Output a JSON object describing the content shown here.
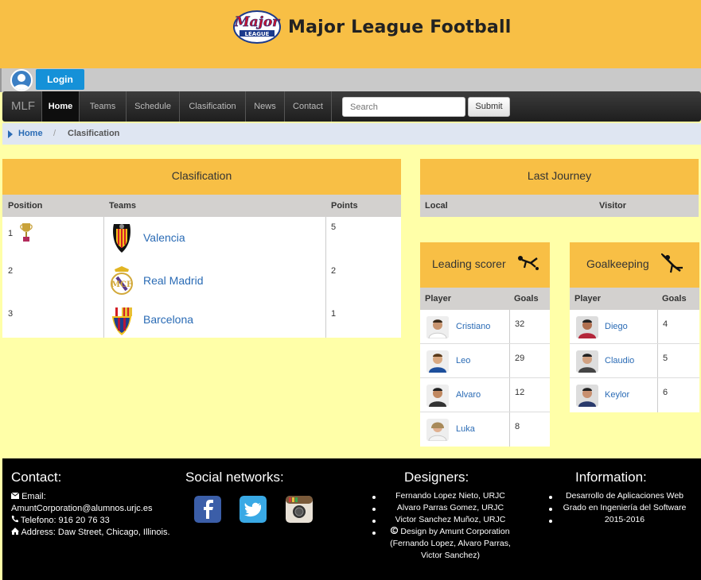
{
  "header": {
    "title": "Major League Football",
    "logo_text": "Major League"
  },
  "login": {
    "label": "Login"
  },
  "nav": {
    "brand": "MLF",
    "items": [
      "Home",
      "Teams",
      "Schedule",
      "Clasification",
      "News",
      "Contact"
    ],
    "active": "Home",
    "search_placeholder": "Search",
    "submit_label": "Submit"
  },
  "breadcrumb": {
    "home": "Home",
    "separator": "/",
    "current": "Clasification"
  },
  "clasification": {
    "title": "Clasification",
    "columns": [
      "Position",
      "Teams",
      "Points"
    ],
    "rows": [
      {
        "position": "1",
        "team": "Valencia",
        "points": "5",
        "trophy": true
      },
      {
        "position": "2",
        "team": "Real Madrid",
        "points": "2"
      },
      {
        "position": "3",
        "team": "Barcelona",
        "points": "1"
      }
    ]
  },
  "last_journey": {
    "title": "Last Journey",
    "columns": [
      "Local",
      "Visitor"
    ]
  },
  "leading_scorer": {
    "title": "Leading scorer",
    "columns": [
      "Player",
      "Goals"
    ],
    "rows": [
      {
        "player": "Cristiano",
        "goals": "32"
      },
      {
        "player": "Leo",
        "goals": "29"
      },
      {
        "player": "Alvaro",
        "goals": "12"
      },
      {
        "player": "Luka",
        "goals": "8"
      }
    ]
  },
  "goalkeeping": {
    "title": "Goalkeeping",
    "columns": [
      "Player",
      "Goals"
    ],
    "rows": [
      {
        "player": "Diego",
        "goals": "4"
      },
      {
        "player": "Claudio",
        "goals": "5"
      },
      {
        "player": "Keylor",
        "goals": "6"
      }
    ]
  },
  "footer": {
    "contact": {
      "title": "Contact:",
      "email_label": "Email:",
      "email": "AmuntCorporation@alumnos.urjc.es",
      "phone": "Telefono: 916 20 76 33",
      "address": "Address: Daw Street, Chicago, Illinois."
    },
    "social": {
      "title": "Social networks:"
    },
    "designers": {
      "title": "Designers:",
      "items": [
        "Fernando Lopez Nieto, URJC",
        "Alvaro Parras Gomez, URJC",
        "Victor Sanchez Muñoz, URJC",
        "Design by Amunt Corporation"
      ],
      "extra_lines": [
        "(Fernando Lopez, Alvaro Parras,",
        "Victor Sanchez)"
      ]
    },
    "information": {
      "title": "Information:",
      "items": [
        "Desarrollo de Aplicaciones Web",
        "Grado en Ingeniería del Software",
        "2015-2016"
      ]
    }
  }
}
